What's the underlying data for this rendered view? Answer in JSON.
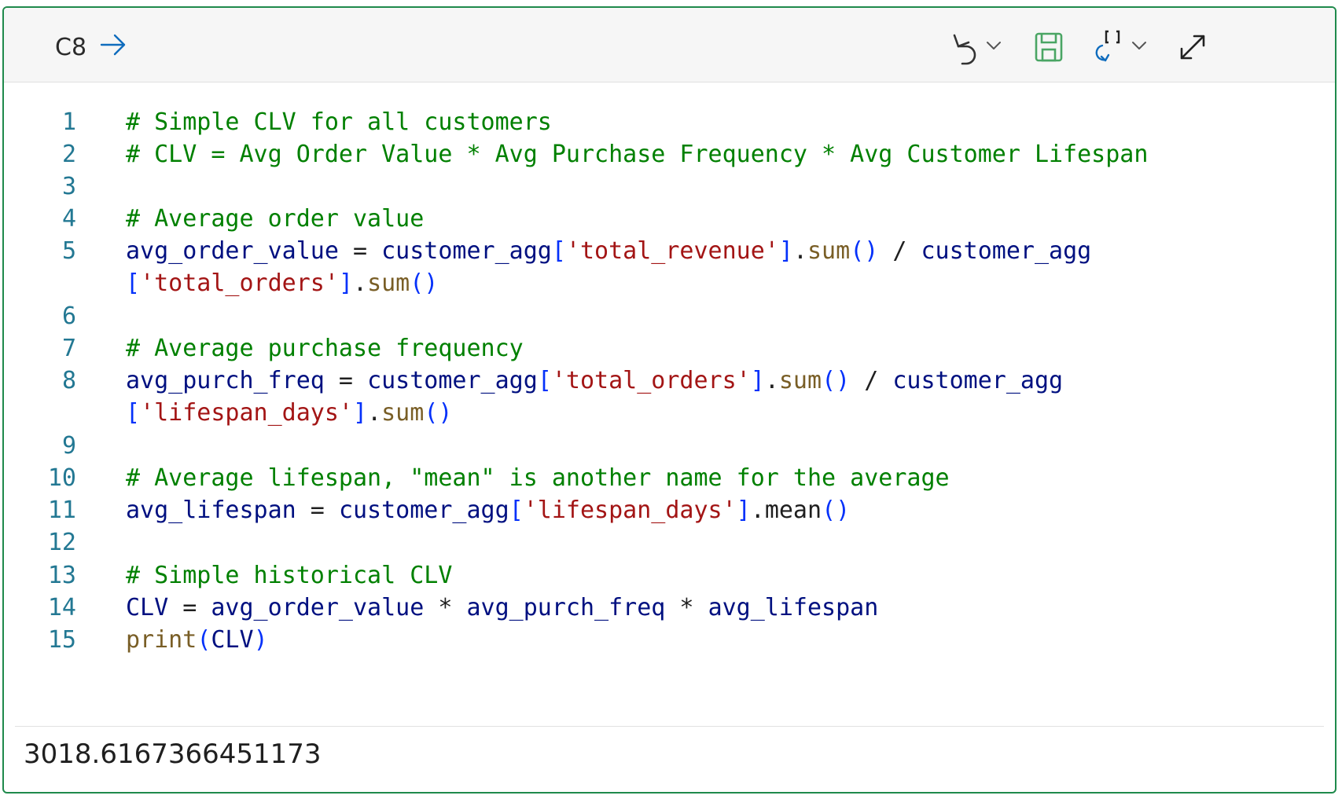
{
  "cell": {
    "id": "C8",
    "icons": {
      "run": "arrow-right-icon",
      "undo": "undo-icon",
      "undo_menu": "chevron-down-icon",
      "save": "save-icon",
      "variables": "variables-refresh-icon",
      "variables_menu": "chevron-down-icon",
      "expand": "expand-icon"
    }
  },
  "editor": {
    "line_numbers": [
      "1",
      "2",
      "3",
      "4",
      "5",
      "6",
      "7",
      "8",
      "9",
      "10",
      "11",
      "12",
      "13",
      "14",
      "15"
    ],
    "lines": {
      "l1": {
        "comment": "# Simple CLV for all customers"
      },
      "l2": {
        "comment": "# CLV = Avg Order Value * Avg Purchase Frequency * Avg Customer Lifespan"
      },
      "l4": {
        "comment": "# Average order value"
      },
      "l5": {
        "var": "avg_order_value",
        "eq": " = ",
        "obj": "customer_agg",
        "ob": "[",
        "str": "'total_revenue'",
        "cb": "]",
        "dot": ".",
        "fn": "sum",
        "par": "()",
        "div": " / ",
        "obj2": "customer_agg"
      },
      "l5b": {
        "ob": "[",
        "str": "'total_orders'",
        "cb": "]",
        "dot": ".",
        "fn": "sum",
        "par": "()"
      },
      "l7": {
        "comment": "# Average purchase frequency"
      },
      "l8": {
        "var": "avg_purch_freq",
        "eq": " = ",
        "obj": "customer_agg",
        "ob": "[",
        "str": "'total_orders'",
        "cb": "]",
        "dot": ".",
        "fn": "sum",
        "par": "()",
        "div": " / ",
        "obj2": "customer_agg"
      },
      "l8b": {
        "ob": "[",
        "str": "'lifespan_days'",
        "cb": "]",
        "dot": ".",
        "fn": "sum",
        "par": "()"
      },
      "l10": {
        "comment": "# Average lifespan, \"mean\" is another name for the average"
      },
      "l11": {
        "var": "avg_lifespan",
        "eq": " = ",
        "obj": "customer_agg",
        "ob": "[",
        "str": "'lifespan_days'",
        "cb": "]",
        "dot": ".",
        "fn": "mean",
        "par": "()"
      },
      "l13": {
        "comment": "# Simple historical CLV"
      },
      "l14": {
        "v1": "CLV",
        "eq": " = ",
        "v2": "avg_order_value",
        "m1": " * ",
        "v3": "avg_purch_freq",
        "m2": " * ",
        "v4": "avg_lifespan"
      },
      "l15": {
        "fn": "print",
        "op": "(",
        "arg": "CLV",
        "cp": ")"
      }
    }
  },
  "output": {
    "text": "3018.6167366451173"
  }
}
